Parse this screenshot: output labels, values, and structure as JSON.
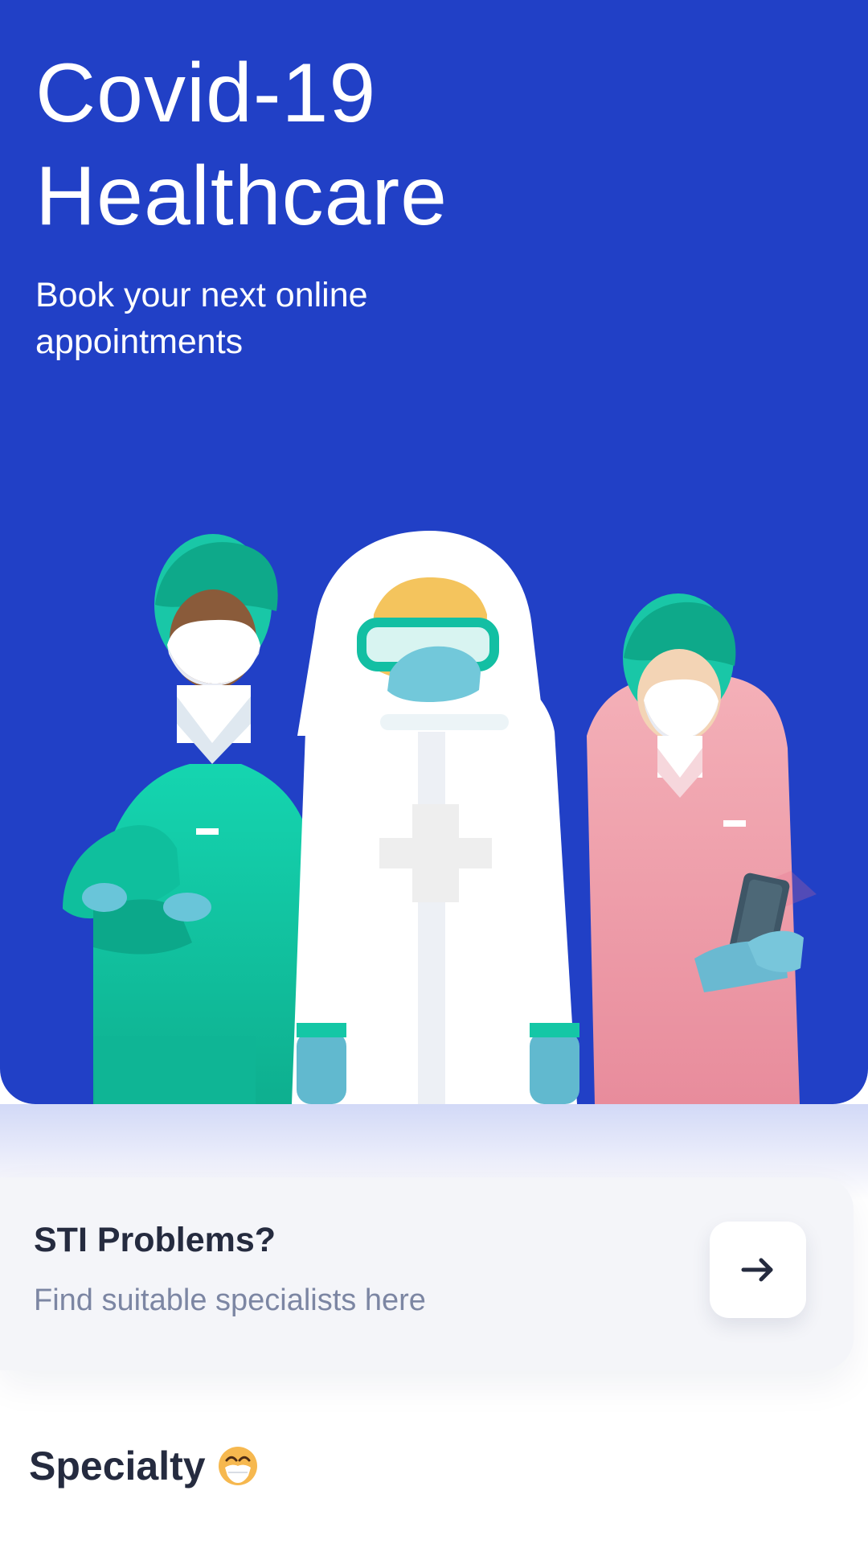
{
  "hero": {
    "title": "Covid-19\nHealthcare",
    "subtitle": "Book your next online appointments"
  },
  "sti_card": {
    "title": "STI Problems?",
    "subtitle": "Find suitable specialists here",
    "action_icon": "arrow-right-icon"
  },
  "specialty": {
    "title": "Specialty",
    "emoji_icon": "face-with-medical-mask-emoji"
  },
  "colors": {
    "hero_background": "#2140c6",
    "card_background": "#f4f5f9",
    "title_text": "#252b3f",
    "muted_text": "#7c86a3",
    "scrubs_green": "#11c8a5",
    "scrubs_pink": "#f1a8b2"
  }
}
